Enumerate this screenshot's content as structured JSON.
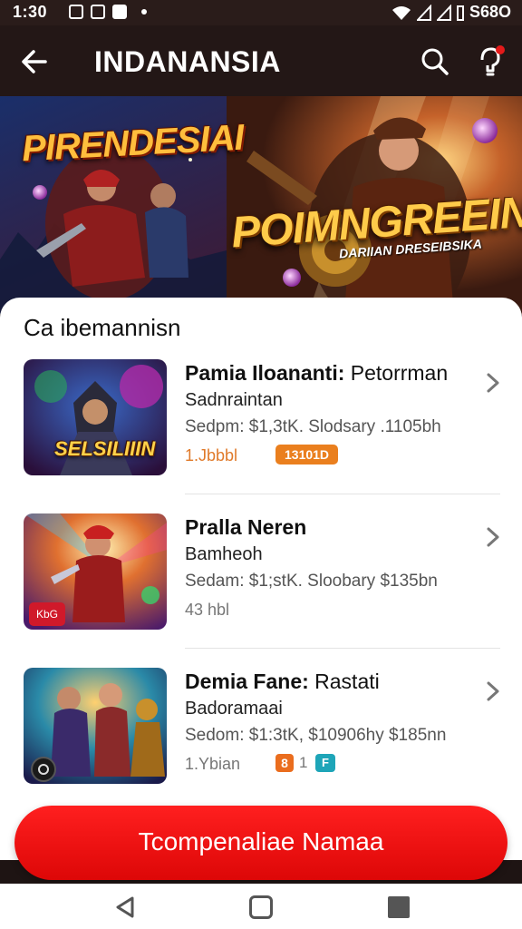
{
  "status_bar": {
    "time": "1:30",
    "battery": "S68O"
  },
  "header": {
    "title": "INDANANSIA",
    "back_icon": "arrow-left-icon",
    "search_icon": "search-icon",
    "notification_icon": "notification-bell-icon"
  },
  "banner": {
    "logo_left": "PIRENDESIAI",
    "logo_right": "POIMNGREEIN",
    "subtitle": "DARIIAN DRESEIBSIKA"
  },
  "section": {
    "title": "Ca ibemannisn"
  },
  "games": [
    {
      "title_bold": "Pamia Iloananti:",
      "title_rest": " Petorrman",
      "subtitle": "Sadnraintan",
      "meta": "Sedpm: $1,3tK. Slodsary .1105bh",
      "count": "1.Jbbbl",
      "tag": "13101D",
      "thumb_caption": "SELSILIIIN"
    },
    {
      "title_bold": "Pralla Neren",
      "title_rest": "",
      "subtitle": "Bamheoh",
      "meta": "Sedam: $1;stK. Sloobary $135bn",
      "count": "43 hbl",
      "thumb_badge": "KbG"
    },
    {
      "title_bold": "Demia Fane:",
      "title_rest": " Rastati",
      "subtitle": "Badoramaai",
      "meta": "Sedom: $1:3tK, $10906hy $185nn",
      "count": "1.Ybian",
      "tag_small": "8",
      "tag_text": "1",
      "tag_teal": "F"
    }
  ],
  "cta": {
    "label": "Tcompenaliae Namaa"
  },
  "colors": {
    "accent": "#e60c0c",
    "header_bg": "#231716",
    "tag_orange": "#ea7f1e",
    "tag_teal": "#1ea5b8"
  }
}
